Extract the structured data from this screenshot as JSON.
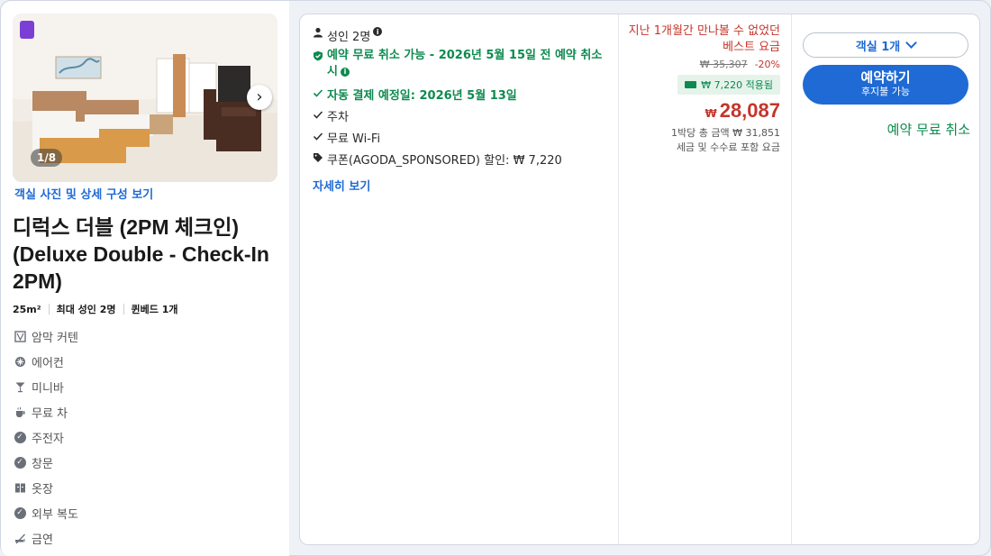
{
  "room": {
    "photo_counter": "1/8",
    "photos_link": "객실 사진 및 상세 구성 보기",
    "title": "디럭스 더블 (2PM 체크인) (Deluxe Double - Check-In 2PM)",
    "specs": [
      "25m²",
      "최대 성인 2명",
      "퀸베드 1개"
    ],
    "amenities": [
      {
        "icon": "blackout-curtain-icon",
        "label": "암막 커텐"
      },
      {
        "icon": "air-conditioner-icon",
        "label": "에어컨"
      },
      {
        "icon": "minibar-icon",
        "label": "미니바"
      },
      {
        "icon": "tea-icon",
        "label": "무료 차"
      },
      {
        "icon": "check-circle-icon",
        "label": "주전자"
      },
      {
        "icon": "check-circle-icon",
        "label": "창문"
      },
      {
        "icon": "wardrobe-icon",
        "label": "옷장"
      },
      {
        "icon": "check-circle-icon",
        "label": "외부 복도"
      },
      {
        "icon": "no-smoking-icon",
        "label": "금연"
      }
    ]
  },
  "offer": {
    "occupancy": "성인 2명",
    "free_cancel": "예약 무료 취소 가능 - 2026년 5월 15일 전 예약 취소 시",
    "auto_pay": "자동 결제 예정일: 2026년 5월 13일",
    "parking": "주차",
    "wifi": "무료 Wi-Fi",
    "coupon": "쿠폰(AGODA_SPONSORED) 할인: ₩ 7,220",
    "more_link": "자세히 보기"
  },
  "price": {
    "deal_text": "지난 1개월간 만나볼 수 없었던 베스트 요금",
    "original": "₩ 35,307",
    "discount_pct": "-20%",
    "coupon_applied": "₩ 7,220 적용됨",
    "currency": "₩",
    "amount": "28,087",
    "total": "1박당 총 금액 ₩ 31,851",
    "tax_note": "세금 및 수수료 포함 요금"
  },
  "booking": {
    "rooms_select": "객실 1개",
    "book_label": "예약하기",
    "book_sub": "후지불 가능",
    "free_cancel": "예약 무료 취소"
  },
  "colors": {
    "accent": "#1f6ad4",
    "green": "#0d8a4f",
    "red": "#c4352b",
    "badge_purple": "#7c3fd6"
  }
}
